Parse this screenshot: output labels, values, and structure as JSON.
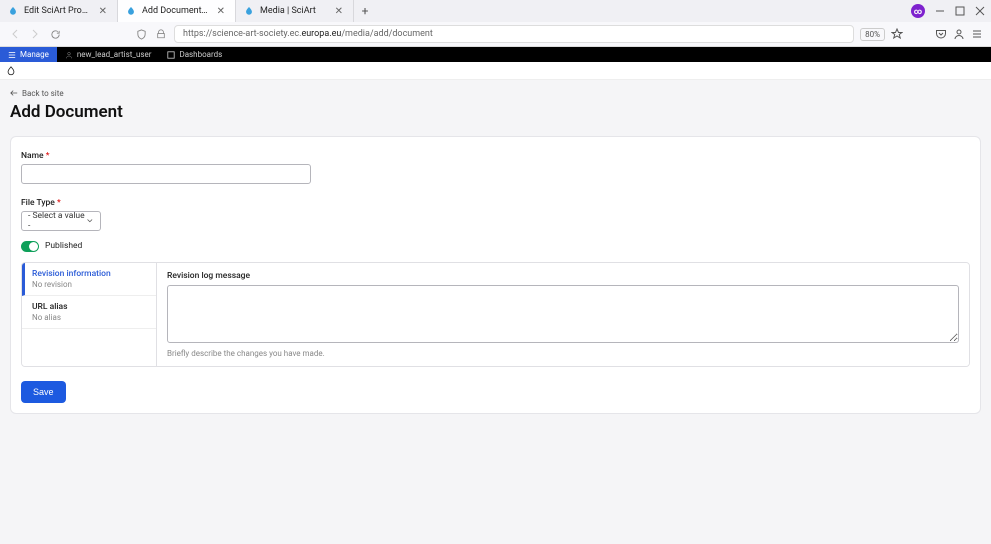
{
  "browser": {
    "tabs": [
      {
        "title": "Edit SciArt Proposals test for lo..."
      },
      {
        "title": "Add Document | SciArt"
      },
      {
        "title": "Media | SciArt"
      }
    ],
    "active_tab_index": 1,
    "url_prefix": "https://",
    "url_mid": "science-art-society.ec.",
    "url_bold": "europa.eu",
    "url_path": "/media/add/document",
    "zoom": "80%"
  },
  "admin_toolbar": {
    "manage": "Manage",
    "user": "new_lead_artist_user",
    "dashboards": "Dashboards"
  },
  "page": {
    "back": "Back to site",
    "title": "Add Document"
  },
  "form": {
    "name_label": "Name",
    "name_value": "",
    "filetype_label": "File Type",
    "filetype_value": "- Select a value -",
    "published_label": "Published",
    "tabs": {
      "revision": {
        "title": "Revision information",
        "sub": "No revision"
      },
      "url_alias": {
        "title": "URL alias",
        "sub": "No alias"
      }
    },
    "revision": {
      "label": "Revision log message",
      "value": "",
      "help": "Briefly describe the changes you have made."
    },
    "save": "Save"
  }
}
